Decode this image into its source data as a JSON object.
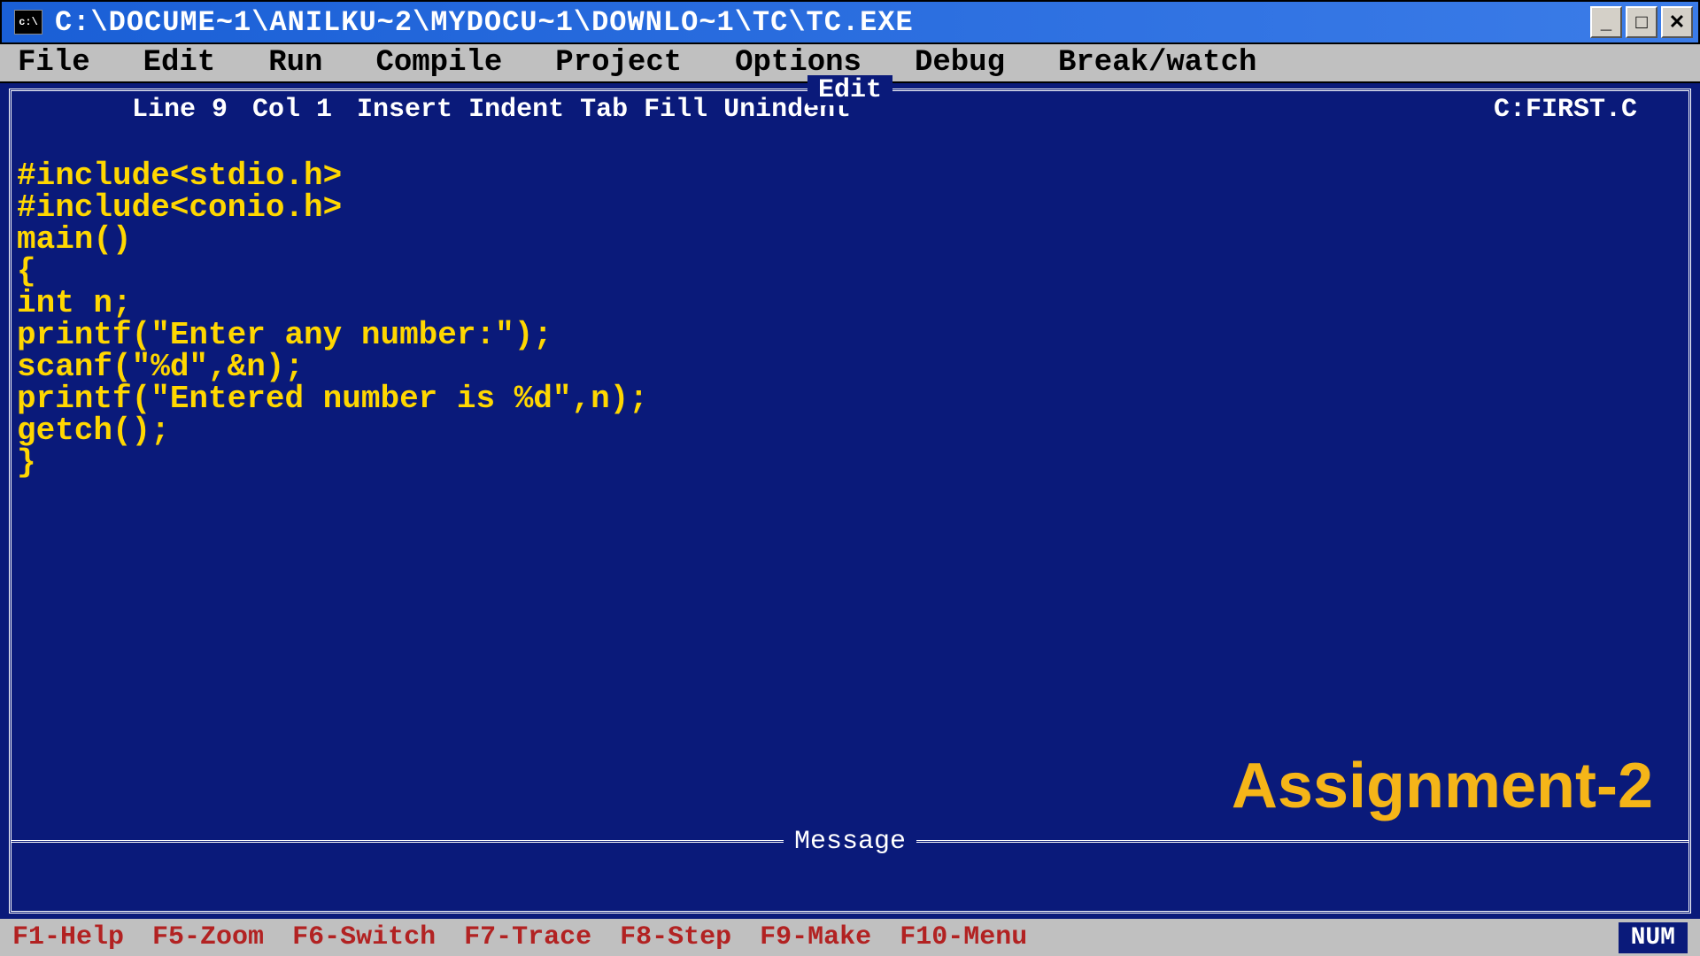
{
  "window": {
    "icon_label": "c:\\",
    "title": "C:\\DOCUME~1\\ANILKU~2\\MYDOCU~1\\DOWNLO~1\\TC\\TC.EXE",
    "controls": {
      "minimize": "_",
      "maximize": "□",
      "close": "✕"
    }
  },
  "menu": {
    "items": [
      "File",
      "Edit",
      "Run",
      "Compile",
      "Project",
      "Options",
      "Debug",
      "Break/watch"
    ]
  },
  "editor": {
    "frame_title": "Edit",
    "status": {
      "line": "Line 9",
      "col": "Col 1",
      "modes": "Insert Indent Tab Fill Unindent",
      "filename": "C:FIRST.C"
    },
    "code_lines": [
      "#include<stdio.h>",
      "#include<conio.h>",
      "main()",
      "{",
      "int n;",
      "printf(\"Enter any number:\");",
      "scanf(\"%d\",&n);",
      "printf(\"Entered number is %d\",n);",
      "getch();",
      "}"
    ],
    "message_title": "Message",
    "overlay": "Assignment-2"
  },
  "bottombar": {
    "shortcuts": [
      "F1-Help",
      "F5-Zoom",
      "F6-Switch",
      "F7-Trace",
      "F8-Step",
      "F9-Make",
      "F10-Menu"
    ],
    "indicator": "NUM"
  }
}
